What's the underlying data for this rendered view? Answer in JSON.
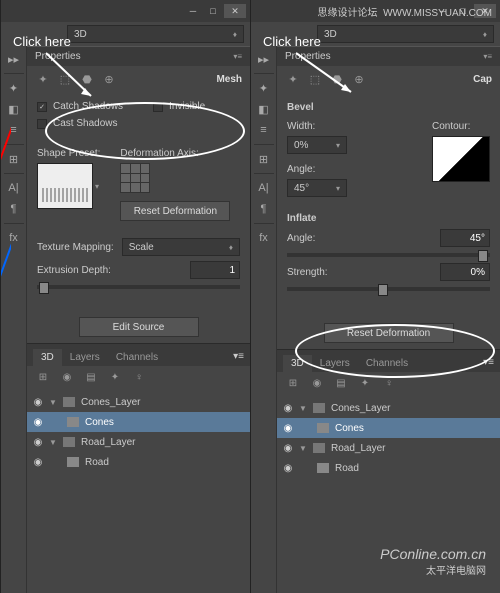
{
  "watermark_top_l": "思缘设计论坛",
  "watermark_top_r": "WWW.MISSYUAN.COM",
  "watermark_bot_1": "PConline.com.cn",
  "watermark_bot_2": "太平洋电脑网",
  "left": {
    "click_here": "Click here",
    "mode": "3D",
    "properties": "Properties",
    "subtitle": "Mesh",
    "catch_shadows": "Catch Shadows",
    "invisible": "Invisible",
    "cast_shadows": "Cast Shadows",
    "shape_preset": "Shape Preset:",
    "deformation_axis": "Deformation Axis:",
    "reset_deformation": "Reset Deformation",
    "texture_mapping": "Texture Mapping:",
    "scale": "Scale",
    "extrusion_depth": "Extrusion Depth:",
    "extrusion_val": "1",
    "edit_source": "Edit Source",
    "tabs": {
      "t3d": "3D",
      "layers": "Layers",
      "channels": "Channels"
    },
    "layers": {
      "cones_layer": "Cones_Layer",
      "cones": "Cones",
      "road_layer": "Road_Layer",
      "road": "Road"
    }
  },
  "right": {
    "click_here": "Click here",
    "mode": "3D",
    "properties": "Properties",
    "subtitle": "Cap",
    "bevel": "Bevel",
    "width": "Width:",
    "width_val": "0%",
    "contour": "Contour:",
    "angle": "Angle:",
    "angle_val": "45°",
    "inflate": "Inflate",
    "inf_angle": "Angle:",
    "inf_angle_val": "45°",
    "strength": "Strength:",
    "strength_val": "0%",
    "reset_deformation": "Reset Deformation",
    "tabs": {
      "t3d": "3D",
      "layers": "Layers",
      "channels": "Channels"
    },
    "layers": {
      "cones_layer": "Cones_Layer",
      "cones": "Cones",
      "road_layer": "Road_Layer",
      "road": "Road"
    }
  }
}
